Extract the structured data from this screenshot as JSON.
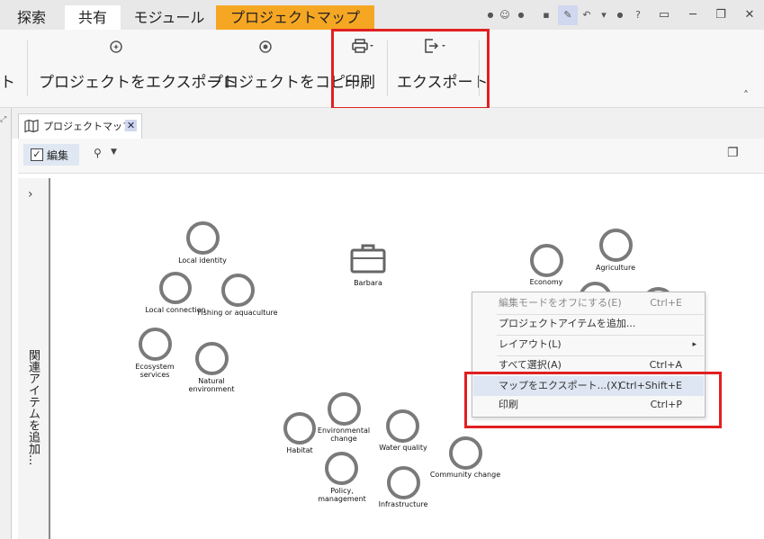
{
  "tabs": {
    "search": "探索",
    "share": "共有",
    "modules": "モジュール",
    "project_map": "プロジェクトマップ"
  },
  "ribbon": {
    "partial_label": "ト",
    "export_project": "プロジェクトをエクスポート",
    "copy_project": "プロジェクトをコピー",
    "print": "印刷",
    "export": "エクスポート"
  },
  "document": {
    "tab_title": "プロジェクトマップ",
    "edit_label": "編集",
    "side_panel_label": "関連アイテムを追加..."
  },
  "map": {
    "center_label": "Barbara",
    "nodes": [
      {
        "label": "Local identity"
      },
      {
        "label": "Local connection"
      },
      {
        "label": "Fishing or aquaculture"
      },
      {
        "label": "Ecosystem services"
      },
      {
        "label": "Natural environment"
      },
      {
        "label": "Economy"
      },
      {
        "label": "Agriculture"
      },
      {
        "label": "Habitat"
      },
      {
        "label": "Environmental change"
      },
      {
        "label": "Water quality"
      },
      {
        "label": "Community change"
      },
      {
        "label": "Policy, management"
      },
      {
        "label": "Infrastructure"
      }
    ]
  },
  "context_menu": {
    "items": [
      {
        "label": "編集モードをオフにする(E)",
        "shortcut": "Ctrl+E"
      },
      {
        "label": "プロジェクトアイテムを追加...",
        "shortcut": ""
      },
      {
        "label": "レイアウト(L)",
        "shortcut": "▸"
      },
      {
        "label": "すべて選択(A)",
        "shortcut": "Ctrl+A"
      },
      {
        "label": "マップをエクスポート...(X)",
        "shortcut": "Ctrl+Shift+E"
      },
      {
        "label": "印刷",
        "shortcut": "Ctrl+P"
      }
    ]
  },
  "colors": {
    "accent_tab": "#f5a623",
    "highlight_box": "#e02020",
    "menu_highlight": "#dde6f2"
  }
}
